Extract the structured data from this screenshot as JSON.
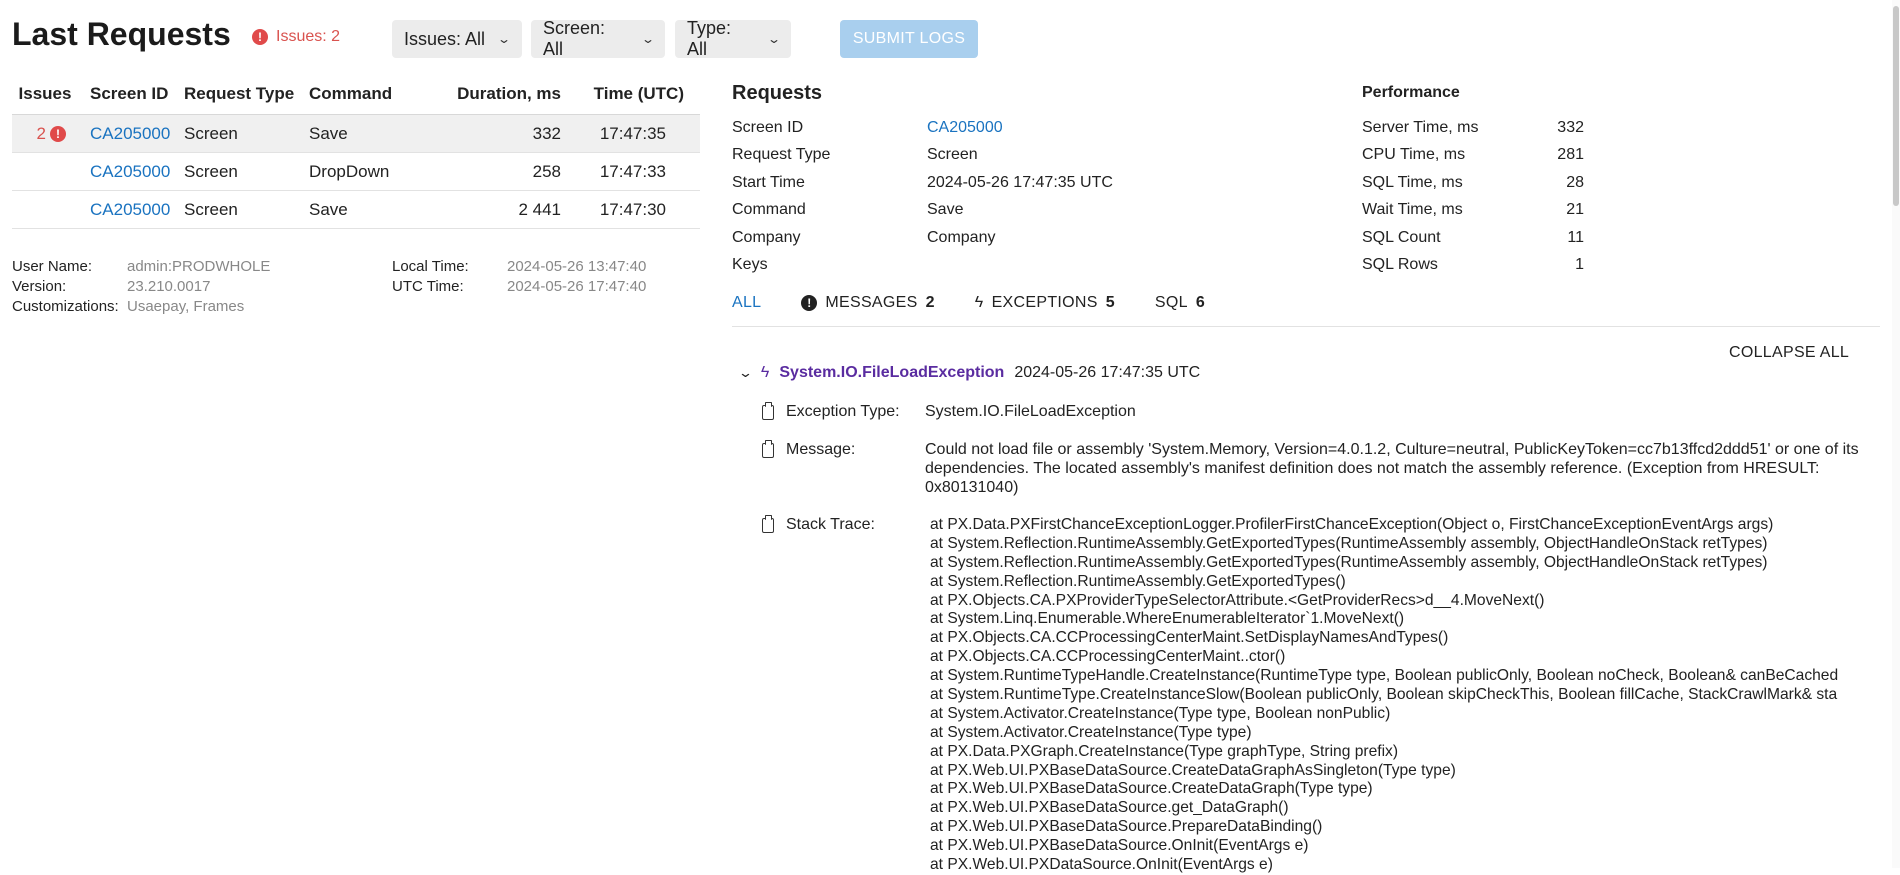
{
  "header": {
    "title": "Last Requests",
    "issues_label": "Issues: 2",
    "filters": [
      {
        "label": "Issues: All"
      },
      {
        "label": "Screen: All"
      },
      {
        "label": "Type: All"
      }
    ],
    "submit_label": "SUBMIT LOGS"
  },
  "requests_table": {
    "columns": [
      "Issues",
      "Screen ID",
      "Request Type",
      "Command",
      "Duration, ms",
      "Time (UTC)"
    ],
    "rows": [
      {
        "issues": "2",
        "screen_id": "CA205000",
        "type": "Screen",
        "command": "Save",
        "duration": "332",
        "time": "17:47:35"
      },
      {
        "issues": "",
        "screen_id": "CA205000",
        "type": "Screen",
        "command": "DropDown",
        "duration": "258",
        "time": "17:47:33"
      },
      {
        "issues": "",
        "screen_id": "CA205000",
        "type": "Screen",
        "command": "Save",
        "duration": "2 441",
        "time": "17:47:30"
      }
    ]
  },
  "info": {
    "user_name_label": "User Name:",
    "user_name": "admin:PRODWHOLE",
    "version_label": "Version:",
    "version": "23.210.0017",
    "customizations_label": "Customizations:",
    "customizations": "Usaepay, Frames",
    "local_time_label": "Local Time:",
    "local_time": "2024-05-26 13:47:40",
    "utc_time_label": "UTC Time:",
    "utc_time": "2024-05-26 17:47:40"
  },
  "request_detail": {
    "title": "Requests",
    "fields": [
      {
        "label": "Screen ID",
        "value": "CA205000"
      },
      {
        "label": "Request Type",
        "value": "Screen"
      },
      {
        "label": "Start Time",
        "value": "2024-05-26 17:47:35 UTC"
      },
      {
        "label": "Command",
        "value": "Save"
      },
      {
        "label": "Company",
        "value": "Company"
      },
      {
        "label": "Keys",
        "value": ""
      }
    ]
  },
  "performance": {
    "title": "Performance",
    "fields": [
      {
        "label": "Server Time, ms",
        "value": "332"
      },
      {
        "label": "CPU Time, ms",
        "value": "281"
      },
      {
        "label": "SQL Time, ms",
        "value": "28"
      },
      {
        "label": "Wait Time, ms",
        "value": "21"
      },
      {
        "label": "SQL Count",
        "value": "11"
      },
      {
        "label": "SQL Rows",
        "value": "1"
      }
    ]
  },
  "tabs": [
    {
      "label": "ALL",
      "count": ""
    },
    {
      "label": "MESSAGES",
      "count": "2"
    },
    {
      "label": "EXCEPTIONS",
      "count": "5"
    },
    {
      "label": "SQL",
      "count": "6"
    }
  ],
  "collapse_label": "COLLAPSE ALL",
  "exception": {
    "name": "System.IO.FileLoadException",
    "time": "2024-05-26 17:47:35 UTC",
    "type_label": "Exception Type:",
    "type_value": "System.IO.FileLoadException",
    "message_label": "Message:",
    "message_lines": [
      "Could not load file or assembly 'System.Memory, Version=4.0.1.2, Culture=neutral, PublicKeyToken=cc7b13ffcd2ddd51' or one of its",
      "dependencies. The located assembly's manifest definition does not match the assembly reference. (Exception from HRESULT:",
      "0x80131040)"
    ],
    "stack_label": "Stack Trace:",
    "stack": [
      "at PX.Data.PXFirstChanceExceptionLogger.ProfilerFirstChanceException(Object o, FirstChanceExceptionEventArgs args)",
      "at System.Reflection.RuntimeAssembly.GetExportedTypes(RuntimeAssembly assembly, ObjectHandleOnStack retTypes)",
      "at System.Reflection.RuntimeAssembly.GetExportedTypes(RuntimeAssembly assembly, ObjectHandleOnStack retTypes)",
      "at System.Reflection.RuntimeAssembly.GetExportedTypes()",
      "at PX.Objects.CA.PXProviderTypeSelectorAttribute.<GetProviderRecs>d__4.MoveNext()",
      "at System.Linq.Enumerable.WhereEnumerableIterator`1.MoveNext()",
      "at PX.Objects.CA.CCProcessingCenterMaint.SetDisplayNamesAndTypes()",
      "at PX.Objects.CA.CCProcessingCenterMaint..ctor()",
      "at System.RuntimeTypeHandle.CreateInstance(RuntimeType type, Boolean publicOnly, Boolean noCheck, Boolean& canBeCached",
      "at System.RuntimeType.CreateInstanceSlow(Boolean publicOnly, Boolean skipCheckThis, Boolean fillCache, StackCrawlMark& sta",
      "at System.Activator.CreateInstance(Type type, Boolean nonPublic)",
      "at System.Activator.CreateInstance(Type type)",
      "at PX.Data.PXGraph.CreateInstance(Type graphType, String prefix)",
      "at PX.Web.UI.PXBaseDataSource.CreateDataGraphAsSingleton(Type type)",
      "at PX.Web.UI.PXBaseDataSource.CreateDataGraph(Type type)",
      "at PX.Web.UI.PXBaseDataSource.get_DataGraph()",
      "at PX.Web.UI.PXBaseDataSource.PrepareDataBinding()",
      "at PX.Web.UI.PXBaseDataSource.OnInit(EventArgs e)",
      "at PX.Web.UI.PXDataSource.OnInit(EventArgs e)"
    ]
  }
}
